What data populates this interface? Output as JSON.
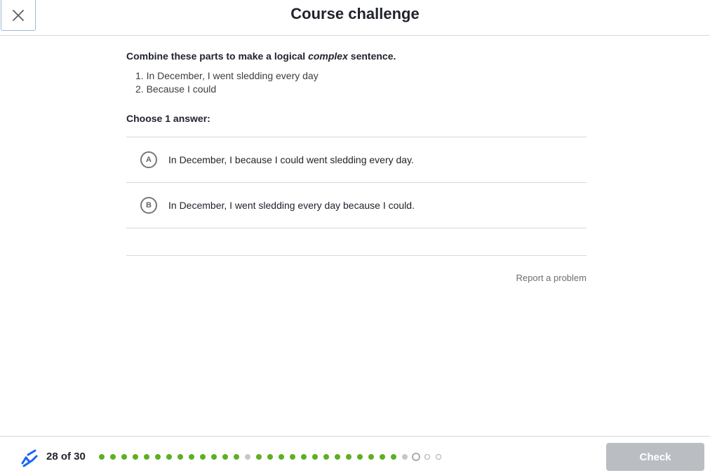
{
  "header": {
    "title": "Course challenge",
    "close_icon": "close-icon"
  },
  "question": {
    "prompt_before": "Combine these parts to make a logical ",
    "prompt_emphasis": "complex",
    "prompt_after": " sentence.",
    "parts": [
      "1. In December, I went sledding every day",
      "2. Because I could"
    ],
    "choose_label": "Choose 1 answer:",
    "choices": [
      {
        "letter": "A",
        "text": "In December, I because I could went sledding every day."
      },
      {
        "letter": "B",
        "text": "In December, I went sledding every day because I could."
      }
    ],
    "report_link": "Report a problem"
  },
  "footer": {
    "progress_label": "28 of 30",
    "progress": {
      "current": 28,
      "total": 30
    },
    "dot_states": [
      "correct",
      "correct",
      "correct",
      "correct",
      "correct",
      "correct",
      "correct",
      "correct",
      "correct",
      "correct",
      "correct",
      "correct",
      "correct",
      "skipped",
      "correct",
      "correct",
      "correct",
      "correct",
      "correct",
      "correct",
      "correct",
      "correct",
      "correct",
      "correct",
      "correct",
      "correct",
      "correct",
      "skipped",
      "current",
      "pending",
      "pending"
    ],
    "check_label": "Check"
  },
  "colors": {
    "correct": "#5cb020",
    "skipped": "#c4c7cb",
    "pending_outline": "#a9abae",
    "check_button_disabled": "#babec2",
    "streak_icon": "#1865f2"
  }
}
